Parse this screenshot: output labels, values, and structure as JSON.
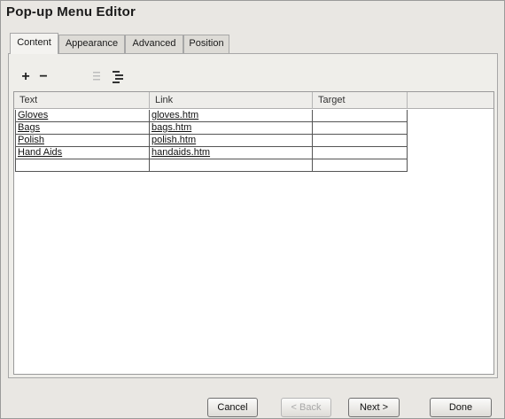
{
  "window": {
    "title": "Pop-up Menu Editor"
  },
  "tabs": [
    {
      "label": "Content",
      "active": true
    },
    {
      "label": "Appearance",
      "active": false
    },
    {
      "label": "Advanced",
      "active": false
    },
    {
      "label": "Position",
      "active": false
    }
  ],
  "toolbar": {
    "add_icon": "plus-icon",
    "remove_icon": "minus-icon",
    "indent_icon": "indent-icon",
    "outdent_icon": "outdent-icon",
    "add_glyph": "+",
    "remove_glyph": "−"
  },
  "grid": {
    "columns": [
      "Text",
      "Link",
      "Target"
    ],
    "rows": [
      {
        "text": "Gloves",
        "link": "gloves.htm",
        "target": ""
      },
      {
        "text": "Bags",
        "link": "bags.htm",
        "target": ""
      },
      {
        "text": "Polish",
        "link": "polish.htm",
        "target": ""
      },
      {
        "text": "Hand Aids",
        "link": "handaids.htm",
        "target": ""
      },
      {
        "text": "",
        "link": "",
        "target": ""
      }
    ]
  },
  "buttons": {
    "cancel": "Cancel",
    "back": "< Back",
    "next": "Next >",
    "done": "Done"
  },
  "colors": {
    "window_bg": "#e9e7e3",
    "panel_bg": "#efeeea",
    "grid_bg": "#ffffff"
  }
}
